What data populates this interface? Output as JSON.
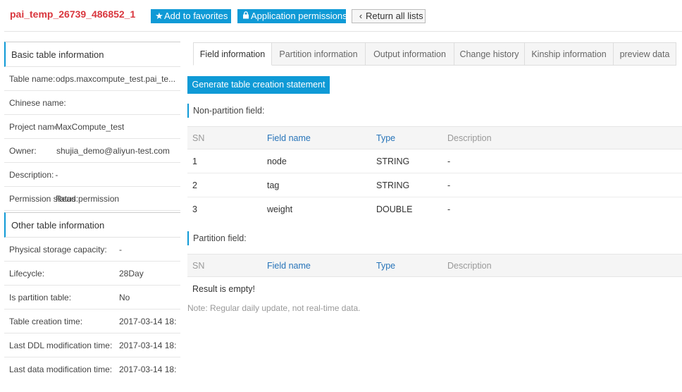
{
  "header": {
    "table_name": "pai_temp_26739_486852_1",
    "add_favorites": "Add to favorites",
    "app_permissions": "Application permissions",
    "return_lists": "Return all lists"
  },
  "basic_info": {
    "title": "Basic table information",
    "rows": [
      {
        "label": "Table name:",
        "value": "odps.maxcompute_test.pai_te..."
      },
      {
        "label": "Chinese name:",
        "value": ""
      },
      {
        "label": "Project name:",
        "value": "MaxCompute_test"
      },
      {
        "label": "Owner:",
        "value": "shujia_demo@aliyun-test.com"
      },
      {
        "label": "Description:",
        "value": "-"
      },
      {
        "label": "Permission status:",
        "value": "Read permission"
      }
    ]
  },
  "other_info": {
    "title": "Other table information",
    "rows": [
      {
        "label": "Physical storage capacity:",
        "value": "-"
      },
      {
        "label": "Lifecycle:",
        "value": "28Day"
      },
      {
        "label": "Is partition table:",
        "value": "No"
      },
      {
        "label": "Table creation time:",
        "value": "2017-03-14 18:"
      },
      {
        "label": "Last DDL modification time:",
        "value": "2017-03-14 18:"
      },
      {
        "label": "Last data modification time:",
        "value": "2017-03-14 18:"
      }
    ]
  },
  "tabs": [
    {
      "label": "Field information",
      "active": true
    },
    {
      "label": "Partition information"
    },
    {
      "label": "Output information"
    },
    {
      "label": "Change history"
    },
    {
      "label": "Kinship information"
    },
    {
      "label": "preview data"
    }
  ],
  "content": {
    "generate_button": "Generate table creation statement",
    "non_partition_label": "Non-partition field:",
    "partition_label": "Partition field:",
    "columns": [
      "SN",
      "Field name",
      "Type",
      "Description"
    ],
    "fields": [
      {
        "sn": "1",
        "name": "node",
        "type": "STRING",
        "desc": "-"
      },
      {
        "sn": "2",
        "name": "tag",
        "type": "STRING",
        "desc": "-"
      },
      {
        "sn": "3",
        "name": "weight",
        "type": "DOUBLE",
        "desc": "-"
      }
    ],
    "partition_empty": "Result is empty!",
    "note": "Note: Regular daily update, not real-time data."
  },
  "colors": {
    "accent": "#0f9ad6",
    "title_red": "#d9363e",
    "link_blue": "#2774b9"
  }
}
